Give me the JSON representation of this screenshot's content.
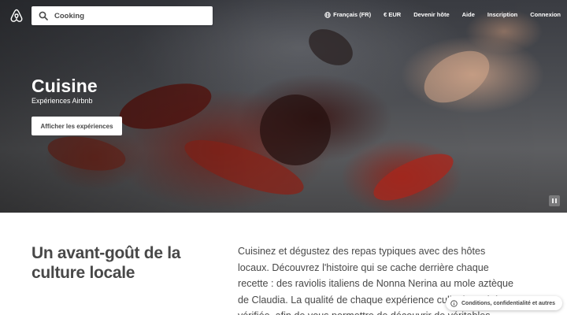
{
  "header": {
    "logo_icon": "airbnb-logo-icon",
    "search": {
      "value": "Cooking",
      "icon": "search-icon"
    },
    "nav": {
      "language": "Français (FR)",
      "currency": "€ EUR",
      "host": "Devenir hôte",
      "help": "Aide",
      "signup": "Inscription",
      "login": "Connexion"
    }
  },
  "hero": {
    "title": "Cuisine",
    "subtitle": "Expériences Airbnb",
    "cta": "Afficher les expériences",
    "pause_icon": "pause-icon"
  },
  "intro": {
    "heading": "Un avant-goût de la culture locale",
    "body": "Cuisinez et dégustez des repas typiques avec des hôtes locaux. Découvrez l'histoire qui se cache derrière chaque recette : des raviolis italiens de Nonna Nerina au mole aztèque de Claudia. La qualité de chaque expérience culinaire a été vérifiée, afin de vous permettre de découvrir de véritables"
  },
  "legal": {
    "label": "Conditions, confidentialité et autres",
    "icon": "info-icon"
  },
  "colors": {
    "brand": "#FF5A5F",
    "text": "#484848"
  }
}
